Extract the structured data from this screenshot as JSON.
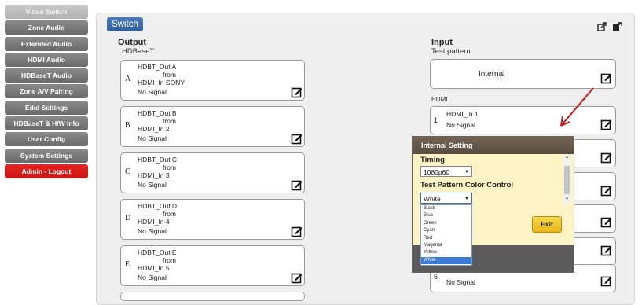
{
  "sidebar": {
    "items": [
      {
        "label": "Video Switch",
        "state": "active"
      },
      {
        "label": "Zone Audio",
        "state": "normal"
      },
      {
        "label": "Extended Audio",
        "state": "normal"
      },
      {
        "label": "HDMI Audio",
        "state": "normal"
      },
      {
        "label": "HDBaseT Audio",
        "state": "normal"
      },
      {
        "label": "Zone A/V Pairing",
        "state": "normal"
      },
      {
        "label": "Edid Settings",
        "state": "normal"
      },
      {
        "label": "HDBaseT & H/W Info",
        "state": "normal"
      },
      {
        "label": "User Config",
        "state": "normal"
      },
      {
        "label": "System Settings",
        "state": "normal"
      },
      {
        "label": "Admin - Logout",
        "state": "logout"
      }
    ]
  },
  "tab": {
    "label": "Switch"
  },
  "output": {
    "title": "Output",
    "subtitle": "HDBaseT",
    "items": [
      {
        "letter": "A",
        "name": "HDBT_Out A",
        "from": "from",
        "source": "HDMI_In SONY",
        "status": "No Signal"
      },
      {
        "letter": "B",
        "name": "HDBT_Out B",
        "from": "from",
        "source": "HDMI_In 2",
        "status": "No Signal"
      },
      {
        "letter": "C",
        "name": "HDBT_Out C",
        "from": "from",
        "source": "HDMI_In 3",
        "status": "No Signal"
      },
      {
        "letter": "D",
        "name": "HDBT_Out D",
        "from": "from",
        "source": "HDMI_In 4",
        "status": "No Signal"
      },
      {
        "letter": "E",
        "name": "HDBT_Out E",
        "from": "from",
        "source": "HDMI_In 5",
        "status": "No Signal"
      }
    ]
  },
  "input": {
    "title": "Input",
    "test_pattern_label": "Test pattern",
    "internal_label": "Internal",
    "hdmi_label": "HDMI",
    "item1": {
      "number": "1",
      "name": "HDMI_In 1",
      "status": "No Signal"
    },
    "item6": {
      "number": "6",
      "status": "No Signal"
    }
  },
  "popup": {
    "title": "Internal Setting",
    "timing_label": "Timing",
    "timing_value": "1080p60",
    "color_label": "Test Pattern Color Control",
    "color_value": "White",
    "color_options": [
      "Black",
      "Blue",
      "Green",
      "Cyan",
      "Red",
      "Magenta",
      "Yellow",
      "White"
    ],
    "selected_option": "White",
    "exit_label": "Exit"
  },
  "colors": {
    "accent": "#3a68a8",
    "logout": "#d91a16",
    "arrow": "#c81c1c",
    "popup_bg": "#fdf3c4"
  }
}
